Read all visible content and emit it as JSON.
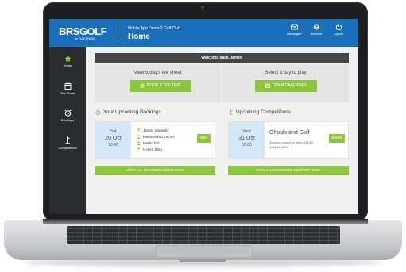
{
  "header": {
    "logo": "BRSGOLF",
    "logo_sub": "by GOLFNOW",
    "club_name": "Mobile App Demo 2 Golf Club",
    "page_title": "Home",
    "actions": [
      {
        "label": "Messages",
        "icon": "envelope-icon"
      },
      {
        "label": "Account",
        "icon": "user-icon"
      },
      {
        "label": "Logout",
        "icon": "power-icon"
      }
    ]
  },
  "sidebar": {
    "items": [
      {
        "label": "Home",
        "icon": "home-icon",
        "active": true
      },
      {
        "label": "Tee Sheet",
        "icon": "calendar-icon"
      },
      {
        "label": "Bookings",
        "icon": "alarm-clock-icon"
      },
      {
        "label": "Competitions",
        "icon": "golf-flag-icon"
      }
    ]
  },
  "welcome": "Welcome back James",
  "tee_sheet": {
    "prompt": "View today's tee sheet",
    "button": "BOOK A TEE TIME"
  },
  "calendar": {
    "prompt": "Select a day to play",
    "button": "OPEN CALENDAR"
  },
  "bookings": {
    "title": "Your Upcoming Bookings",
    "card": {
      "day": "Sat",
      "date": "20 Oct",
      "time": "10:40",
      "players": [
        "James Donaghy",
        "Matthew MD Demo!",
        "Martin Fitz",
        "Robert King"
      ],
      "action": "EDIT"
    },
    "view_all": "VIEW ALL UPCOMING BOOKINGS"
  },
  "competitions": {
    "title": "Upcoming Competitions",
    "card": {
      "day": "Wed",
      "date": "31 Oct",
      "time": "09:00",
      "name": "Ghouls and Golf",
      "detail": "Booking closes on Wed 31 Oct 2018 at 11:00",
      "action": "ENTER"
    },
    "view_all": "VIEW ALL UPCOMING COMPETITIONS"
  },
  "colors": {
    "header_blue": "#1a6fbd",
    "sidebar_dark": "#2a2c30",
    "accent_green": "#8cc63f",
    "date_blue": "#d2e8f7"
  }
}
